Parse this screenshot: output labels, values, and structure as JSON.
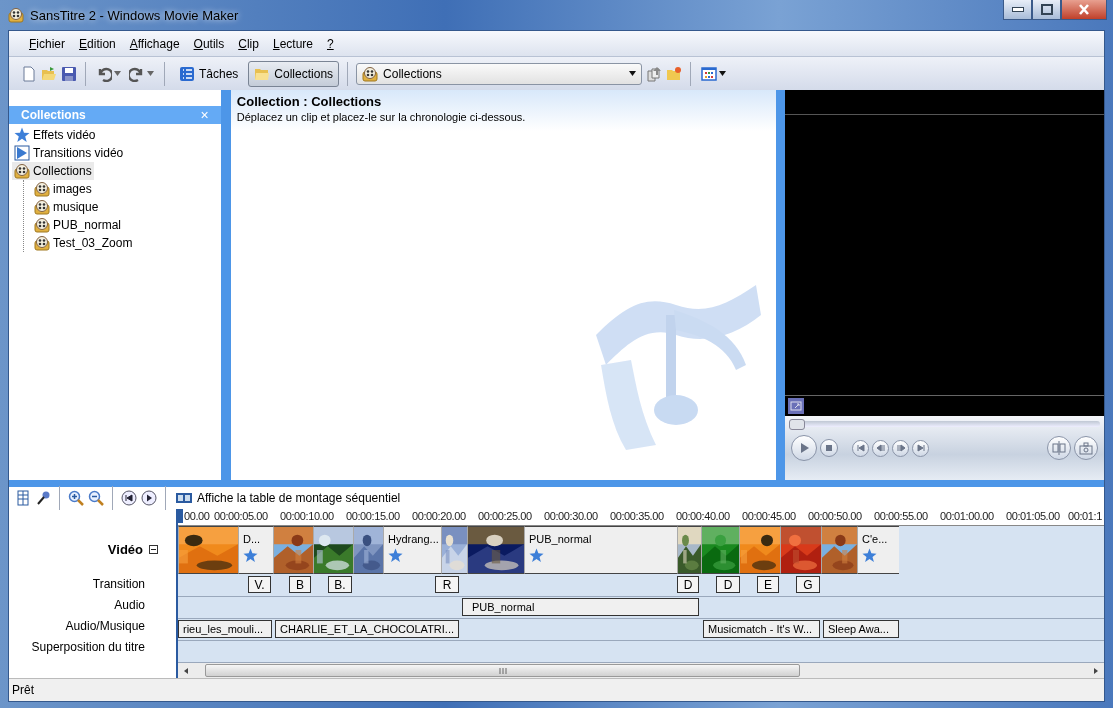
{
  "window": {
    "title": "SansTitre 2 - Windows Movie Maker"
  },
  "menu": [
    {
      "label": "Fichier"
    },
    {
      "label": "Edition"
    },
    {
      "label": "Affichage"
    },
    {
      "label": "Outils"
    },
    {
      "label": "Clip"
    },
    {
      "label": "Lecture"
    },
    {
      "label": "?"
    }
  ],
  "toolbar": {
    "tasks_button": {
      "label": "Tâches",
      "selected": false
    },
    "collections_button": {
      "label": "Collections",
      "selected": true
    },
    "collection_dropdown": {
      "value": "Collections"
    }
  },
  "collections_pane": {
    "title": "Collections",
    "close": "×",
    "tree": [
      {
        "label": "Effets vidéo",
        "kind": "effects",
        "selected": false
      },
      {
        "label": "Transitions vidéo",
        "kind": "transitions",
        "selected": false
      },
      {
        "label": "Collections",
        "kind": "collection",
        "selected": true,
        "children": [
          {
            "label": "images",
            "kind": "collection",
            "selected": false
          },
          {
            "label": "musique",
            "kind": "collection",
            "selected": false
          },
          {
            "label": "PUB_normal",
            "kind": "collection",
            "selected": false
          },
          {
            "label": "Test_03_Zoom",
            "kind": "collection",
            "selected": false
          }
        ]
      }
    ]
  },
  "content": {
    "heading": "Collection : Collections",
    "hint": "Déplacez un clip et placez-le sur la chronologie ci-dessous."
  },
  "timeline": {
    "storyboard_button": "Affiche la table de montage séquentiel",
    "ruler": [
      "00.00",
      "00:00:05.00",
      "00:00:10.00",
      "00:00:15.00",
      "00:00:20.00",
      "00:00:25.00",
      "00:00:30.00",
      "00:00:35.00",
      "00:00:40.00",
      "00:00:45.00",
      "00:00:50.00",
      "00:00:55.00",
      "00:01:00.00",
      "00:01:05.00",
      "00:01:1"
    ],
    "tracks": [
      {
        "label": "Vidéo",
        "kind": "video",
        "expanded": true
      },
      {
        "label": "Transition",
        "kind": "transition"
      },
      {
        "label": "Audio",
        "kind": "audio"
      },
      {
        "label": "Audio/Musique",
        "kind": "music"
      },
      {
        "label": "Superposition du titre",
        "kind": "overlay"
      }
    ],
    "video_clips": [
      {
        "kind": "picture"
      },
      {
        "kind": "title",
        "label": "D..."
      },
      {
        "kind": "picture"
      },
      {
        "kind": "picture"
      },
      {
        "kind": "picture"
      },
      {
        "kind": "title",
        "label": "Hydrang..."
      },
      {
        "kind": "picture"
      },
      {
        "kind": "picture"
      },
      {
        "kind": "title",
        "label": "PUB_normal"
      },
      {
        "kind": "picture"
      },
      {
        "kind": "picture"
      },
      {
        "kind": "picture"
      },
      {
        "kind": "picture"
      },
      {
        "kind": "picture"
      },
      {
        "kind": "title",
        "label": "C'e..."
      }
    ],
    "transitions": [
      {
        "label": "V."
      },
      {
        "label": "B"
      },
      {
        "label": "B."
      },
      {
        "label": "R"
      },
      {
        "label": "D"
      },
      {
        "label": "D"
      },
      {
        "label": "E"
      },
      {
        "label": "G"
      }
    ],
    "audio_clips": [
      {
        "label": "PUB_normal"
      }
    ],
    "music_clips": [
      {
        "label": "rieu_les_mouli..."
      },
      {
        "label": "CHARLIE_ET_LA_CHOCOLATRI..."
      },
      {
        "label": "Musicmatch - It's W..."
      },
      {
        "label": "Sleep Awa..."
      }
    ]
  },
  "status_bar": {
    "text": "Prêt"
  }
}
